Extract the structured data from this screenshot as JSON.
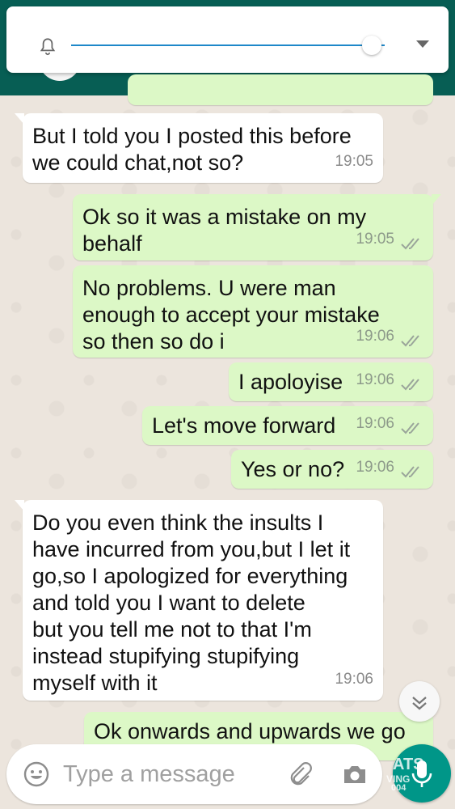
{
  "volume_popup": {
    "level_fraction": 0.96
  },
  "messages": [
    {
      "dir": "in",
      "text": "But I told you I posted this before\nwe could chat,not so?",
      "time": "19:05"
    },
    {
      "dir": "out",
      "text": "Ok so it was a mistake on my\nbehalf",
      "time": "19:05"
    },
    {
      "dir": "out",
      "text": "No problems. U were man\nenough to accept your mistake\nso then so do i",
      "time": "19:06"
    },
    {
      "dir": "out",
      "text": "I apoloyise",
      "time": "19:06"
    },
    {
      "dir": "out",
      "text": "Let's move forward",
      "time": "19:06"
    },
    {
      "dir": "out",
      "text": "Yes or no?",
      "time": "19:06"
    },
    {
      "dir": "in",
      "text": "Do you even think the insults I\nhave incurred from you,but I let it\ngo,so I apologized for everything\nand told you I want to delete\nbut you tell me not to that I'm\ninstead stupifying stupifying\nmyself with it",
      "time": "19:06"
    },
    {
      "dir": "out",
      "text": "Ok onwards and upwards we go",
      "time": ""
    }
  ],
  "composer": {
    "placeholder": "Type a message"
  },
  "colors": {
    "header": "#075e54",
    "outgoing_bubble": "#dcf8c6",
    "incoming_bubble": "#ffffff",
    "accent": "#009688",
    "slider": "#1e88c9"
  },
  "icons": [
    "bell-icon",
    "chevron-down-icon",
    "double-check-icon",
    "scroll-down-icon",
    "emoji-icon",
    "paperclip-icon",
    "camera-icon",
    "mic-icon"
  ],
  "watermark": {
    "line1": "ATS",
    "line2": "VING",
    "line3": "004"
  }
}
